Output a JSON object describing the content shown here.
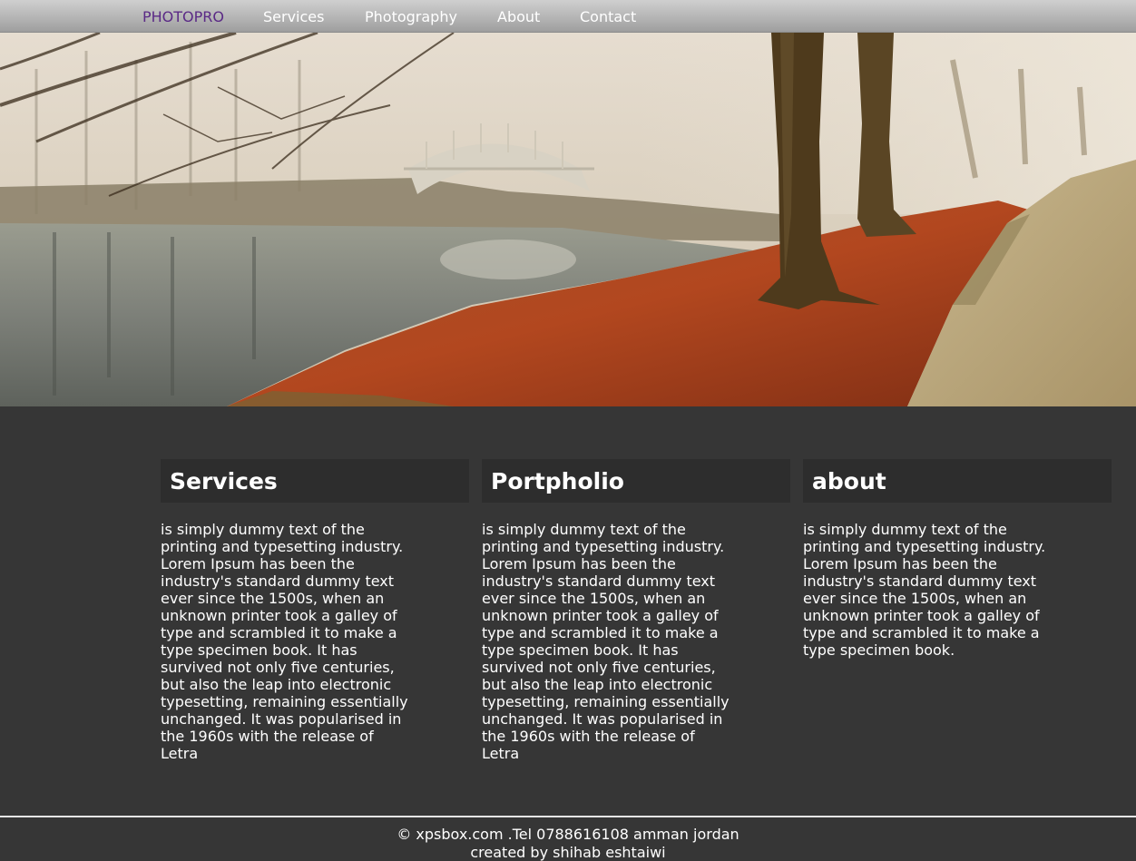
{
  "nav": {
    "brand": "PHOTOPRO",
    "links": [
      "Services",
      "Photography",
      "About",
      "Contact"
    ]
  },
  "hero": {
    "image": "misty autumn park with canal, stone footbridge, trees and red fallen leaves"
  },
  "sections": [
    {
      "title": "Services",
      "text": "is simply dummy text of the printing and typesetting industry. Lorem Ipsum has been the industry's standard dummy text ever since the 1500s, when an unknown printer took a galley of type and scrambled it to make a type specimen book. It has survived not only five centuries, but also the leap into electronic typesetting, remaining essentially unchanged. It was popularised in the 1960s with the release of Letra"
    },
    {
      "title": "Portpholio",
      "text": "is simply dummy text of the printing and typesetting industry. Lorem Ipsum has been the industry's standard dummy text ever since the 1500s, when an unknown printer took a galley of type and scrambled it to make a type specimen book. It has survived not only five centuries, but also the leap into electronic typesetting, remaining essentially unchanged. It was popularised in the 1960s with the release of Letra"
    },
    {
      "title": "about",
      "text": "is simply dummy text of the printing and typesetting industry. Lorem Ipsum has been the industry's standard dummy text ever since the 1500s, when an unknown printer took a galley of type and scrambled it to make a type specimen book."
    }
  ],
  "footer": {
    "line1": "© xpsbox.com .Tel 0788616108 amman jordan",
    "line2": "created by shihab eshtaiwi"
  },
  "colors": {
    "background": "#363636",
    "heading_bg": "#2d2d2d",
    "brand": "#5b2a86",
    "nav_gradient_top": "#cfcfcf",
    "nav_gradient_bottom": "#9e9e9e"
  }
}
